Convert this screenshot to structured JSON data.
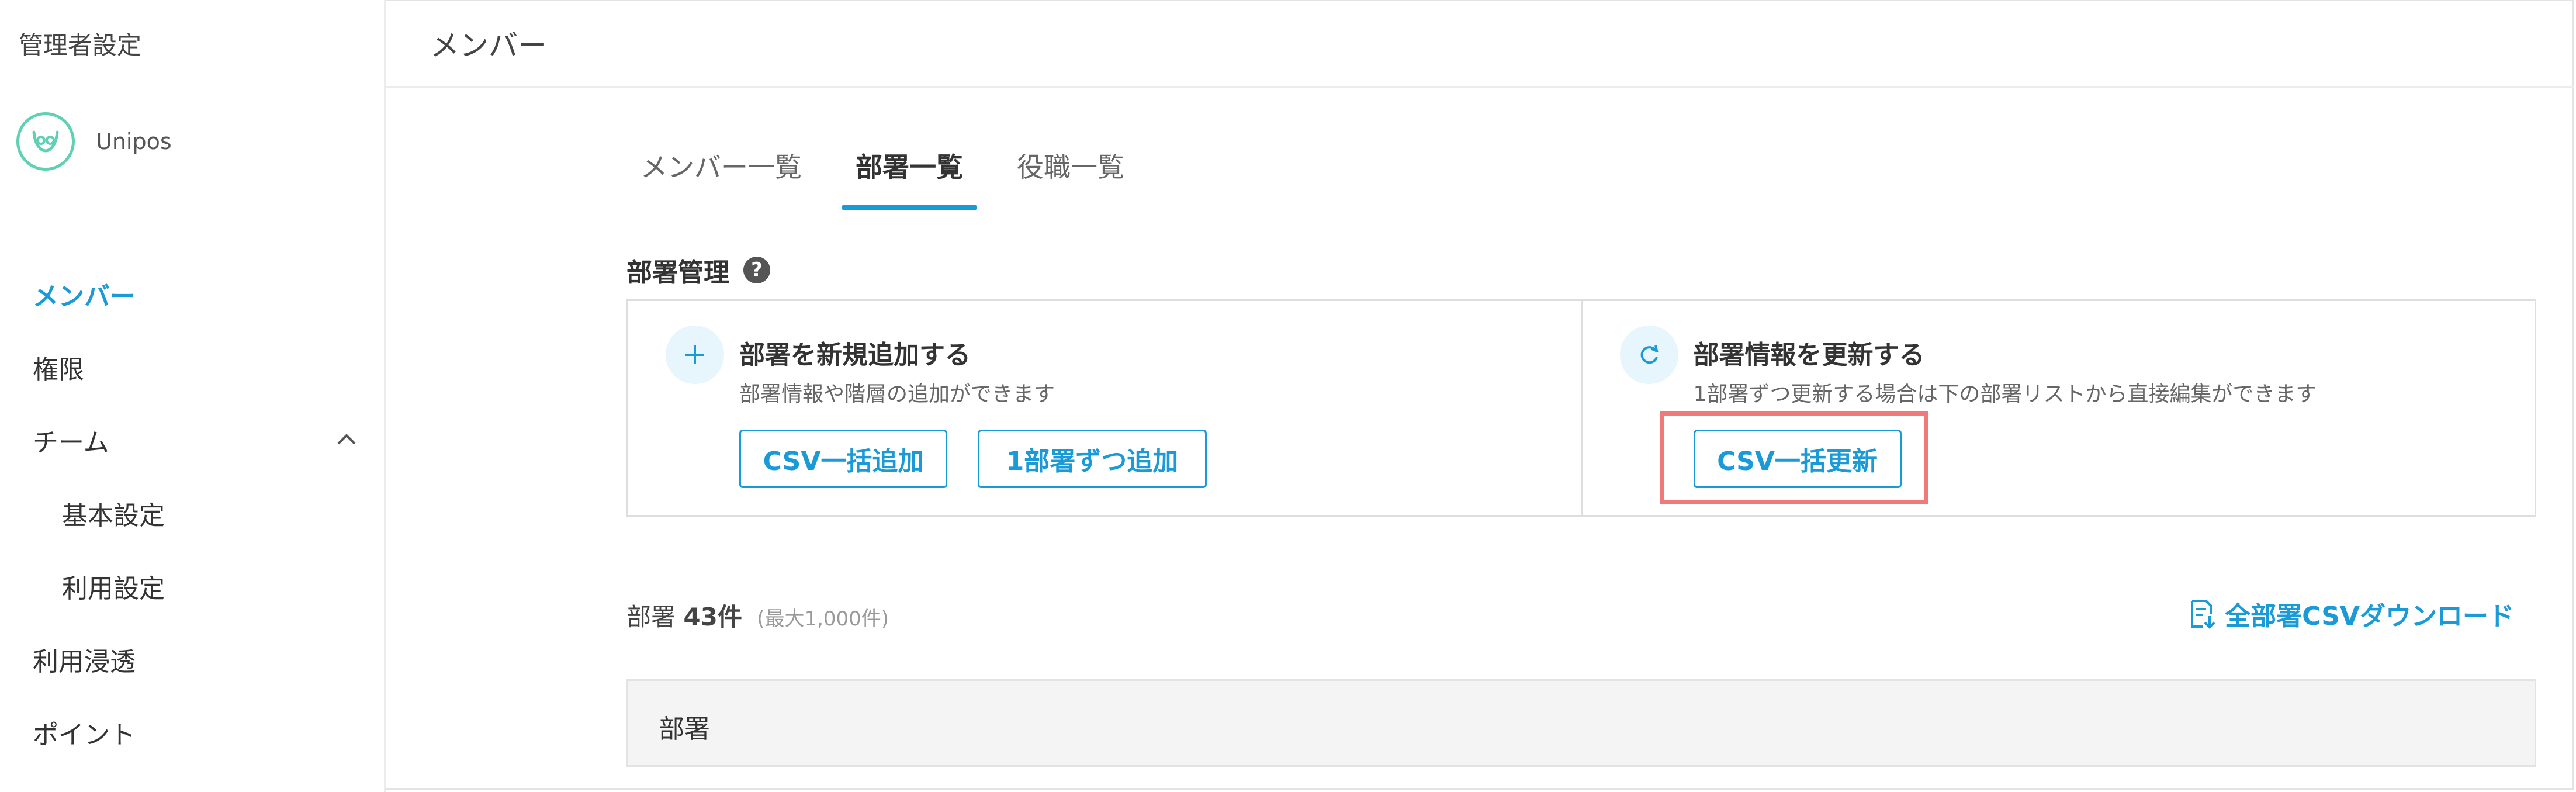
{
  "sidebar": {
    "title": "管理者設定",
    "org_name": "Unipos",
    "items": [
      {
        "label": "メンバー",
        "active": true
      },
      {
        "label": "権限"
      },
      {
        "label": "チーム",
        "expandable": true
      },
      {
        "label": "基本設定",
        "sub": true
      },
      {
        "label": "利用設定",
        "sub": true
      },
      {
        "label": "利用浸透"
      },
      {
        "label": "ポイント"
      }
    ]
  },
  "header": {
    "title": "メンバー"
  },
  "tabs": [
    {
      "label": "メンバー一覧"
    },
    {
      "label": "部署一覧",
      "active": true
    },
    {
      "label": "役職一覧"
    }
  ],
  "section": {
    "title": "部署管理",
    "help": "?"
  },
  "cards": {
    "add": {
      "title": "部署を新規追加する",
      "desc": "部署情報や階層の追加ができます",
      "btn_csv": "CSV一括追加",
      "btn_single": "1部署ずつ追加"
    },
    "update": {
      "title": "部署情報を更新する",
      "desc": "1部署ずつ更新する場合は下の部署リストから直接編集ができます",
      "btn_csv": "CSV一括更新"
    }
  },
  "list": {
    "label": "部署",
    "count": "43件",
    "max": "(最大1,000件)",
    "download": "全部署CSVダウンロード",
    "column_header": "部署"
  },
  "colors": {
    "accent": "#1a9ad6",
    "highlight": "#f07a7a",
    "logo": "#5fd0b4"
  },
  "icons": [
    "plus-icon",
    "refresh-icon",
    "download-icon",
    "help-icon",
    "chevron-up-icon",
    "unipos-logo"
  ]
}
